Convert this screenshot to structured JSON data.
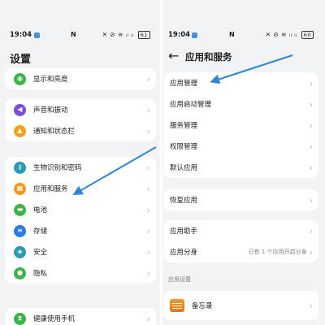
{
  "left_screen": {
    "status_bar": {
      "time": "19:04",
      "nfc": "N",
      "icons": "✕ ⊘ ≋ ᵢₗ ᵢₗ",
      "battery": "61"
    },
    "title": "设置",
    "cards": [
      {
        "items": [
          {
            "label": "显示和亮度",
            "icon": "eye-icon",
            "color": "#3bb54a"
          }
        ]
      },
      {
        "items": [
          {
            "label": "声音和振动",
            "icon": "sound-icon",
            "color": "#7a4fd6"
          },
          {
            "label": "通知和状态栏",
            "icon": "bell-icon",
            "color": "#f2a11d"
          }
        ]
      },
      {
        "items": [
          {
            "label": "生物识别和密码",
            "icon": "key-icon",
            "color": "#2b9bb5"
          },
          {
            "label": "应用和服务",
            "icon": "apps-icon",
            "color": "#f29a1d"
          },
          {
            "label": "电池",
            "icon": "battery-icon",
            "color": "#3bb54a"
          },
          {
            "label": "存储",
            "icon": "storage-icon",
            "color": "#2c7be5"
          },
          {
            "label": "安全",
            "icon": "shield-icon",
            "color": "#2b9bb5"
          },
          {
            "label": "隐私",
            "icon": "privacy-icon",
            "color": "#3bb54a"
          }
        ]
      },
      {
        "items": [
          {
            "label": "健康使用手机",
            "icon": "hourglass-icon",
            "color": "#3bb54a"
          }
        ]
      }
    ]
  },
  "right_screen": {
    "status_bar": {
      "time": "19:04",
      "nfc": "N",
      "icons": "✕ ⊘ ≋ ᵢₗ ᵢₗ",
      "battery": "60"
    },
    "title": "应用和服务",
    "cards": [
      {
        "items": [
          {
            "label": "应用管理"
          },
          {
            "label": "应用启动管理"
          },
          {
            "label": "服务管理"
          },
          {
            "label": "权限管理"
          },
          {
            "label": "默认应用"
          }
        ]
      },
      {
        "items": [
          {
            "label": "恢复应用"
          }
        ]
      },
      {
        "items": [
          {
            "label": "应用助手",
            "sub": ""
          },
          {
            "label": "应用分身",
            "sub": "已有 1 个应用开启分身"
          }
        ]
      }
    ],
    "section_label": "应用设置",
    "memo": {
      "label": "备忘录",
      "icon": "memo-icon"
    }
  },
  "accent_colors": {
    "annotation_arrow": "#2f86d2"
  }
}
